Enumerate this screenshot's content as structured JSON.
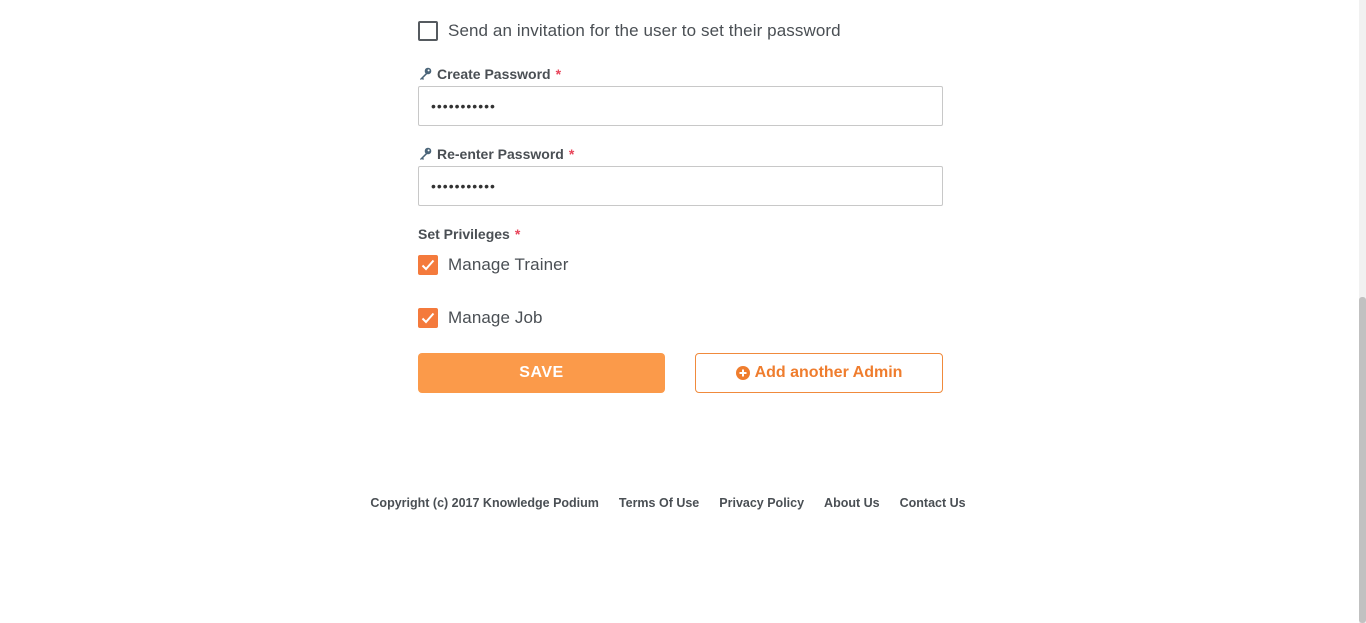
{
  "form": {
    "invite_label": "Send an invitation for the user to set their password",
    "invite_checked": false,
    "create_password": {
      "label": "Create Password",
      "required_mark": "*",
      "value": "•••••••••••"
    },
    "reenter_password": {
      "label": "Re-enter Password",
      "required_mark": "*",
      "value": "•••••••••••"
    },
    "privileges": {
      "label": "Set Privileges",
      "required_mark": "*",
      "items": [
        {
          "label": "Manage Trainer",
          "checked": true
        },
        {
          "label": "Manage Job",
          "checked": true
        }
      ]
    },
    "save_label": "SAVE",
    "add_admin_label": "Add another Admin"
  },
  "footer": {
    "copyright": "Copyright (c) 2017 Knowledge Podium",
    "links": [
      "Terms Of Use",
      "Privacy Policy",
      "About Us",
      "Contact Us"
    ]
  },
  "colors": {
    "accent": "#f47a3c",
    "save_button": "#fb9a4a",
    "required": "#e8455a"
  },
  "icons": {
    "field_icon": "key-icon",
    "add_icon": "plus-circle-icon",
    "check_icon": "checkmark-icon"
  }
}
